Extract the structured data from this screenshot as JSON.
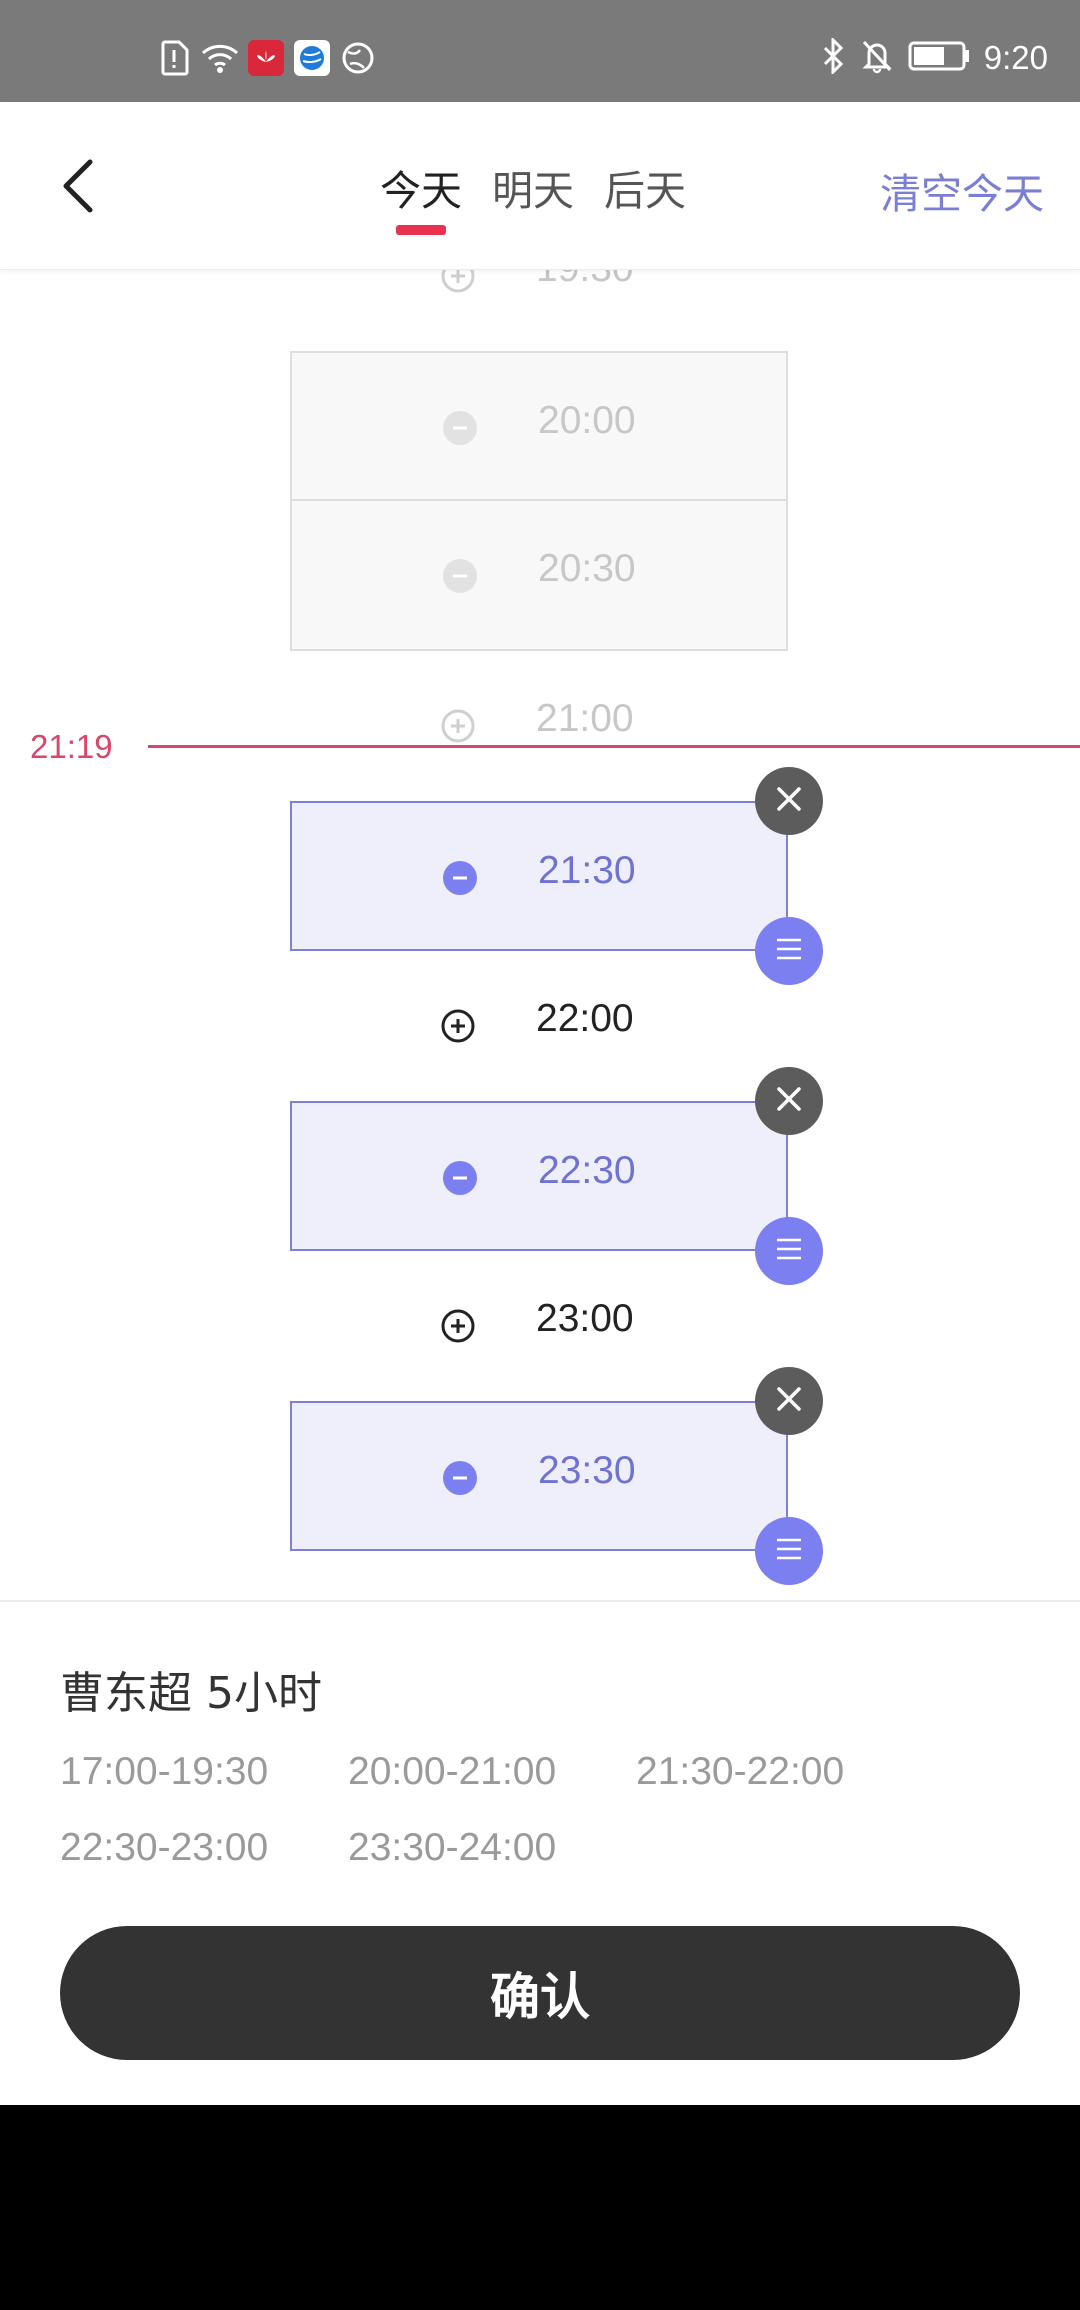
{
  "status_bar": {
    "time": "9:20",
    "left_icons": [
      "sim-alert-icon",
      "wifi-icon",
      "huawei-app-icon",
      "globe-app-icon",
      "globe-outline-icon"
    ],
    "right_icons": [
      "bluetooth-icon",
      "bell-muted-icon",
      "battery-icon"
    ]
  },
  "header": {
    "tabs": [
      {
        "label": "今天",
        "active": true
      },
      {
        "label": "明天",
        "active": false
      },
      {
        "label": "后天",
        "active": false
      }
    ],
    "clear_label": "清空今天",
    "accent": "#e8324f"
  },
  "schedule": {
    "now_label": "21:19",
    "slots": [
      {
        "time": "19:30",
        "state": "faded-free"
      },
      {
        "time": "20:00",
        "state": "past-selected"
      },
      {
        "time": "20:30",
        "state": "past-selected"
      },
      {
        "time": "21:00",
        "state": "faded-free"
      },
      {
        "time": "21:30",
        "state": "selected"
      },
      {
        "time": "22:00",
        "state": "free"
      },
      {
        "time": "22:30",
        "state": "selected"
      },
      {
        "time": "23:00",
        "state": "free"
      },
      {
        "time": "23:30",
        "state": "selected"
      }
    ]
  },
  "footer": {
    "summary": "曹东超 5小时",
    "ranges": [
      "17:00-19:30",
      "20:00-21:00",
      "21:30-22:00",
      "22:30-23:00",
      "23:30-24:00"
    ],
    "confirm_label": "确认"
  },
  "colors": {
    "selected_text": "#6f73cf",
    "now_line": "#d9466a",
    "drag_button": "#7b7ff0",
    "close_button": "#5c5c5c"
  }
}
